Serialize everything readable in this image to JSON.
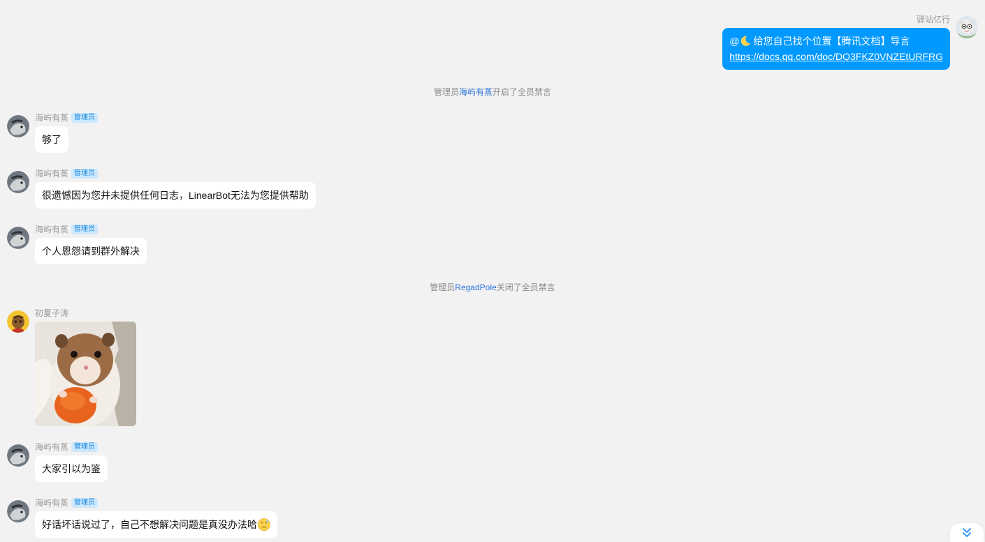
{
  "outgoing": {
    "sender": "驿站亿行",
    "line1_prefix": "@",
    "line1_text": "给您自己找个位置【腾讯文档】导言",
    "link": "https://docs.qq.com/doc/DQ3FKZ0VNZEtURFRG"
  },
  "notices": [
    {
      "prefix": "管理员",
      "who": "海屿有蒸",
      "suffix": "开启了全员禁言"
    },
    {
      "prefix": "管理员",
      "who": "RegadPole",
      "suffix": "关闭了全员禁言"
    }
  ],
  "messages": [
    {
      "sender": "海屿有蒸",
      "badge": "管理员",
      "text": "够了"
    },
    {
      "sender": "海屿有蒸",
      "badge": "管理员",
      "text": "很遗憾因为您并未提供任何日志，LinearBot无法为您提供帮助"
    },
    {
      "sender": "海屿有蒸",
      "badge": "管理员",
      "text": "个人恩怨请到群外解决"
    },
    {
      "sender": "初夏子涛",
      "image": "hamster-holding-carrot-photo"
    },
    {
      "sender": "海屿有蒸",
      "badge": "管理员",
      "text": "大家引以为鉴"
    },
    {
      "sender": "海屿有蒸",
      "badge": "管理员",
      "text": "好话坏话说过了，自己不想解决问题是真没办法哈",
      "emoji": "awkward-smile-emoji"
    }
  ],
  "icons": {
    "scroll_down": "double-chevron-down-icon"
  },
  "colors": {
    "background": "#f2f2f2",
    "outgoing_bubble": "#0099ff",
    "admin_badge_bg": "#cce8ff",
    "admin_badge_text": "#1a8ad9",
    "notice_link": "#2b74d8"
  }
}
